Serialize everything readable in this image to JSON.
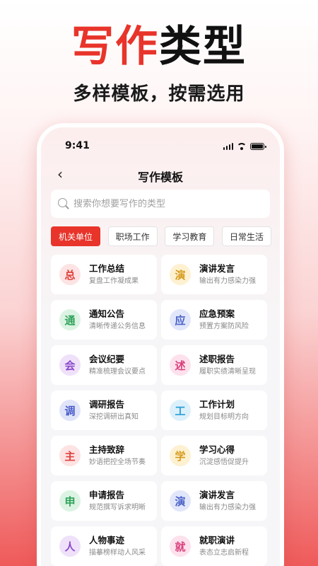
{
  "promo": {
    "title_red": "写作",
    "title_black": "类型",
    "subtitle": "多样模板，按需选用"
  },
  "status": {
    "time": "9:41"
  },
  "nav": {
    "title": "写作模板",
    "back_glyph": "‹"
  },
  "search": {
    "placeholder": "搜索你想要写作的类型"
  },
  "tabs": [
    {
      "label": "机关单位",
      "active": true
    },
    {
      "label": "职场工作",
      "active": false
    },
    {
      "label": "学习教育",
      "active": false
    },
    {
      "label": "日常生活",
      "active": false
    }
  ],
  "templates": [
    {
      "char": "总",
      "title": "工作总结",
      "desc": "复盘工作凝成果",
      "fg": "#e0413c",
      "bg": "#fde3e3"
    },
    {
      "char": "演",
      "title": "演讲发言",
      "desc": "输出有力感染力强",
      "fg": "#d69a1a",
      "bg": "#fdf1d2"
    },
    {
      "char": "通",
      "title": "通知公告",
      "desc": "清晰传递公务信息",
      "fg": "#2fa25a",
      "bg": "#dcf3e3"
    },
    {
      "char": "应",
      "title": "应急预案",
      "desc": "预置方案防风险",
      "fg": "#4a62c8",
      "bg": "#e1e6fa"
    },
    {
      "char": "会",
      "title": "会议纪要",
      "desc": "精准梳理会议要点",
      "fg": "#8b49c9",
      "bg": "#efe1fa"
    },
    {
      "char": "述",
      "title": "述职报告",
      "desc": "履职实绩清晰呈现",
      "fg": "#d8407d",
      "bg": "#fde1ec"
    },
    {
      "char": "调",
      "title": "调研报告",
      "desc": "深挖调研出真知",
      "fg": "#4a5bc8",
      "bg": "#e0e4f9"
    },
    {
      "char": "工",
      "title": "工作计划",
      "desc": "规划目标明方向",
      "fg": "#2a9ed6",
      "bg": "#dcf0fb"
    },
    {
      "char": "主",
      "title": "主持致辞",
      "desc": "妙语把控全场节奏",
      "fg": "#e0413c",
      "bg": "#fde3e3"
    },
    {
      "char": "学",
      "title": "学习心得",
      "desc": "沉淀感悟促提升",
      "fg": "#d69a1a",
      "bg": "#fdf1d2"
    },
    {
      "char": "申",
      "title": "申请报告",
      "desc": "规范撰写诉求明晰",
      "fg": "#2fa25a",
      "bg": "#dcf3e3"
    },
    {
      "char": "演",
      "title": "演讲发言",
      "desc": "输出有力感染力强",
      "fg": "#4a62c8",
      "bg": "#e1e6fa"
    },
    {
      "char": "人",
      "title": "人物事迹",
      "desc": "描摹榜样动人风采",
      "fg": "#8b49c9",
      "bg": "#efe1fa"
    },
    {
      "char": "就",
      "title": "就职演讲",
      "desc": "表态立志启新程",
      "fg": "#d8407d",
      "bg": "#fde1ec"
    }
  ]
}
